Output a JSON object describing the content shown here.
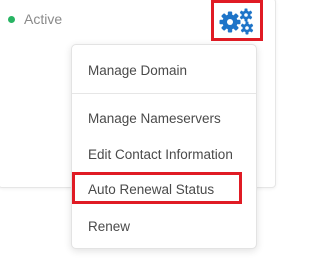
{
  "status": {
    "label": "Active",
    "dot_color": "#28b463"
  },
  "settings_button": {
    "icon": "gears-icon",
    "icon_color": "#1e74c8",
    "highlight_color": "#e01b24"
  },
  "menu": {
    "items": [
      {
        "label": "Manage Domain"
      },
      {
        "label": "Manage Nameservers"
      },
      {
        "label": "Edit Contact Information"
      },
      {
        "label": "Auto Renewal Status",
        "highlighted": true
      },
      {
        "label": "Renew"
      }
    ]
  }
}
